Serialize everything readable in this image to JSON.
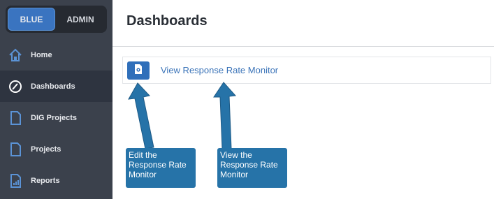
{
  "mode_toggle": {
    "blue_label": "BLUE",
    "admin_label": "ADMIN"
  },
  "nav": [
    {
      "label": "Home",
      "icon": "home-icon"
    },
    {
      "label": "Dashboards",
      "icon": "dashboard-icon"
    },
    {
      "label": "DIG Projects",
      "icon": "document-icon"
    },
    {
      "label": "Projects",
      "icon": "document-icon"
    },
    {
      "label": "Reports",
      "icon": "report-icon"
    }
  ],
  "main": {
    "title": "Dashboards",
    "rows": [
      {
        "link": "View Response Rate Monitor",
        "edit_icon": "edit-settings-icon"
      }
    ]
  },
  "annotations": {
    "edit_callout": "Edit the Response Rate Monitor",
    "view_callout": "View the Response Rate Monitor"
  },
  "colors": {
    "sidebar": "#3b414c",
    "accent": "#3a74c0",
    "callout": "#2673a8",
    "link": "#3a73b8"
  }
}
